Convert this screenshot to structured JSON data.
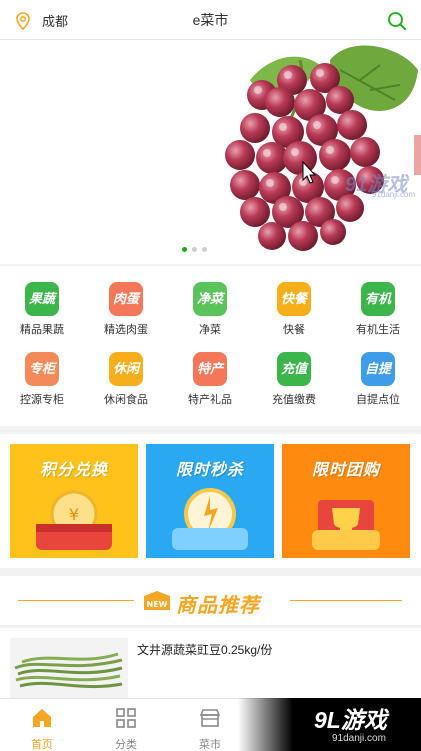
{
  "header": {
    "location": "成都",
    "title": "e菜市",
    "location_icon": "location-pin-icon",
    "search_icon": "search-icon"
  },
  "banner": {
    "image": "grapes",
    "slides": 3,
    "active_slide": 1,
    "watermark": "91游戏",
    "watermark_sub": "91danji.com"
  },
  "categories": [
    {
      "icon_text": "果蔬",
      "label": "精品果蔬",
      "color": "#3cb54a"
    },
    {
      "icon_text": "肉蛋",
      "label": "精选肉蛋",
      "color": "#f4775a"
    },
    {
      "icon_text": "净菜",
      "label": "净菜",
      "color": "#5bc35b"
    },
    {
      "icon_text": "快餐",
      "label": "快餐",
      "color": "#f6ae1b"
    },
    {
      "icon_text": "有机",
      "label": "有机生活",
      "color": "#3cb54a"
    },
    {
      "icon_text": "专柜",
      "label": "控源专柜",
      "color": "#f48a5a"
    },
    {
      "icon_text": "休闲",
      "label": "休闲食品",
      "color": "#f6ae1b"
    },
    {
      "icon_text": "特产",
      "label": "特产礼品",
      "color": "#f4775a"
    },
    {
      "icon_text": "充值",
      "label": "充值缴费",
      "color": "#3cb54a"
    },
    {
      "icon_text": "自提",
      "label": "自提点位",
      "color": "#3f9ce8"
    }
  ],
  "promos": [
    {
      "title": "积分兑换",
      "color": "#ffc21a"
    },
    {
      "title": "限时秒杀",
      "color": "#2aa8f2"
    },
    {
      "title": "限时团购",
      "color": "#ff8a10"
    }
  ],
  "recommend": {
    "badge": "NEW",
    "title": "商品推荐"
  },
  "products": [
    {
      "name": "文井源蔬菜豇豆0.25kg/份"
    }
  ],
  "tabs": [
    {
      "label": "首页",
      "icon": "home-icon",
      "active": true
    },
    {
      "label": "分类",
      "icon": "grid-icon",
      "active": false
    },
    {
      "label": "菜市",
      "icon": "store-icon",
      "active": false
    }
  ],
  "watermark": {
    "main": "9L游戏",
    "sub": "91danji.com"
  }
}
